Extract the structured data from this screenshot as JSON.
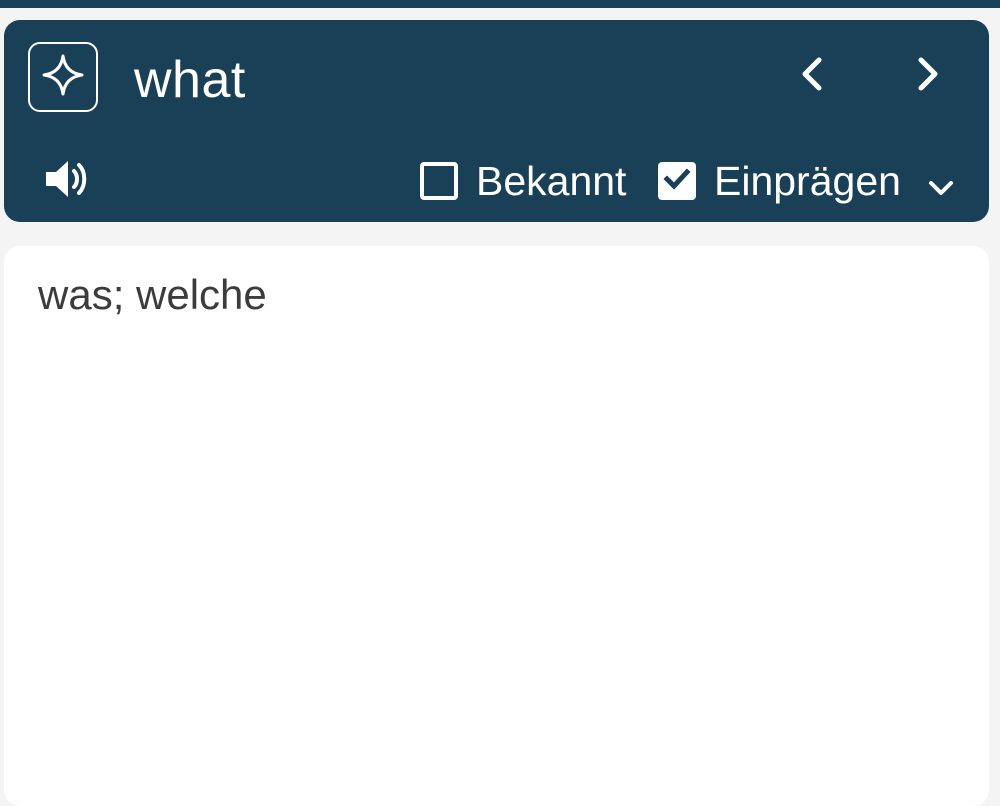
{
  "header": {
    "ai_icon": "sparkle-icon",
    "word": "what",
    "prev_icon": "chevron-left-icon",
    "next_icon": "chevron-right-icon",
    "speaker_icon": "speaker-icon",
    "known": {
      "label": "Bekannt",
      "checked": false
    },
    "memorize": {
      "label": "Einprägen",
      "checked": true
    },
    "dropdown_icon": "chevron-down-icon"
  },
  "content": {
    "translation": "was; welche"
  },
  "colors": {
    "header_bg": "#1a4057",
    "page_bg": "#f4f4f4",
    "card_bg": "#ffffff",
    "text": "#3c3c3c"
  }
}
